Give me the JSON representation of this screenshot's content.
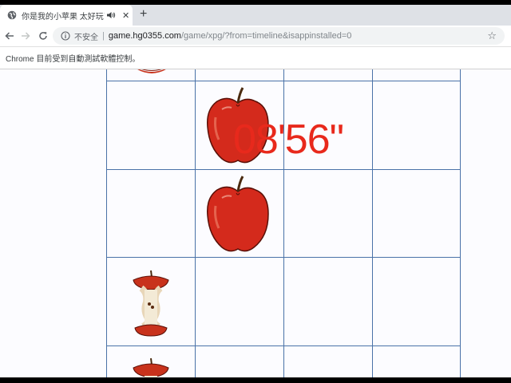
{
  "tab": {
    "title": "你是我的小苹果 太好玩了",
    "close": "✕"
  },
  "new_tab": "+",
  "toolbar": {
    "insecure_label": "不安全",
    "separator": "|",
    "url_host": "game.hg0355.com",
    "url_path": "/game/xpg/?from=timeline&isappinstalled=0",
    "bookmark_star": "☆"
  },
  "infobar": {
    "message": "Chrome 目前受到自動測試軟體控制。"
  },
  "game": {
    "timer": "08'56\"",
    "grid_rows": [
      [
        "apple-core",
        "",
        "",
        ""
      ],
      [
        "",
        "apple",
        "",
        ""
      ],
      [
        "",
        "apple",
        "",
        ""
      ],
      [
        "apple-core",
        "",
        "",
        ""
      ],
      [
        "apple-core",
        "",
        "",
        ""
      ]
    ]
  },
  "colors": {
    "grid_line": "#4a72a8",
    "timer": "#e8291c",
    "apple_red": "#d42a1c",
    "page_bg": "#fcfcff"
  }
}
